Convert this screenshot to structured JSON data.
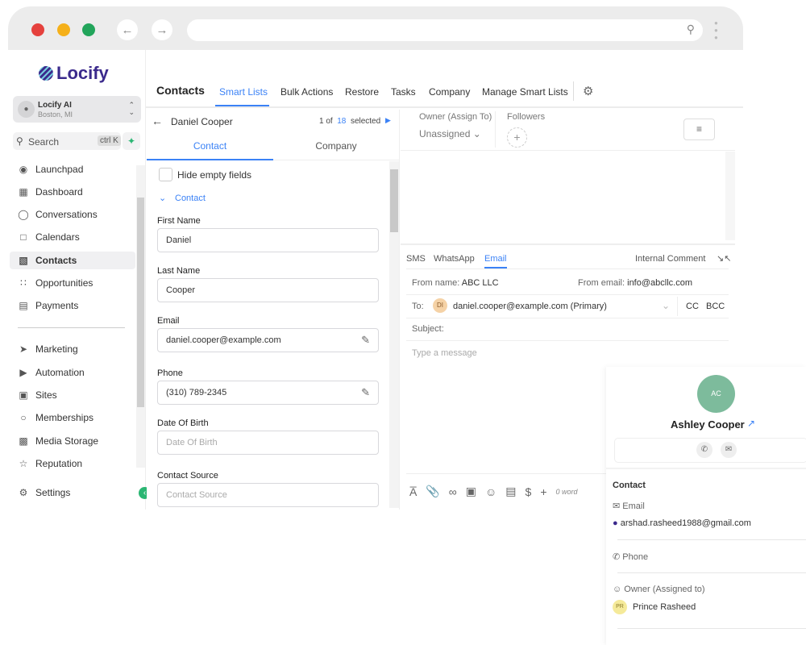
{
  "browser": {
    "url": ""
  },
  "brand": {
    "logo": "Locify"
  },
  "account": {
    "name": "Locify AI",
    "location": "Boston, MI"
  },
  "search": {
    "label": "Search",
    "shortcut": "ctrl K"
  },
  "sidebar": {
    "items": [
      {
        "label": "Launchpad",
        "icon": "rocket-icon"
      },
      {
        "label": "Dashboard",
        "icon": "grid-icon"
      },
      {
        "label": "Conversations",
        "icon": "chat-icon"
      },
      {
        "label": "Calendars",
        "icon": "calendar-icon"
      },
      {
        "label": "Contacts",
        "icon": "contact-icon",
        "active": true
      },
      {
        "label": "Opportunities",
        "icon": "opportunities-icon"
      },
      {
        "label": "Payments",
        "icon": "payments-icon"
      },
      {
        "label": "Marketing",
        "icon": "send-icon"
      },
      {
        "label": "Automation",
        "icon": "automation-icon"
      },
      {
        "label": "Sites",
        "icon": "sites-icon"
      },
      {
        "label": "Memberships",
        "icon": "badge-icon"
      },
      {
        "label": "Media Storage",
        "icon": "image-icon"
      },
      {
        "label": "Reputation",
        "icon": "star-icon"
      }
    ],
    "settings": "Settings"
  },
  "header": {
    "title": "Contacts",
    "tabs": [
      "Smart Lists",
      "Bulk Actions",
      "Restore",
      "Tasks",
      "Company",
      "Manage Smart Lists"
    ],
    "active_tab": "Smart Lists"
  },
  "record": {
    "name": "Daniel Cooper",
    "pos": "1 of",
    "total": "18",
    "selected": "selected",
    "tabs": [
      "Contact",
      "Company"
    ],
    "hide_empty": "Hide empty fields",
    "section": "Contact"
  },
  "fields": [
    {
      "label": "First Name",
      "value": "Daniel",
      "placeholder": ""
    },
    {
      "label": "Last Name",
      "value": "Cooper",
      "placeholder": ""
    },
    {
      "label": "Email",
      "value": "daniel.cooper@example.com",
      "placeholder": "",
      "edit": true
    },
    {
      "label": "Phone",
      "value": "(310) 789-2345",
      "placeholder": "",
      "edit": true
    },
    {
      "label": "Date Of Birth",
      "value": "",
      "placeholder": "Date Of Birth"
    },
    {
      "label": "Contact Source",
      "value": "",
      "placeholder": "Contact Source"
    }
  ],
  "owner": {
    "label": "Owner (Assign To)",
    "value": "Unassigned",
    "followers": "Followers"
  },
  "composer": {
    "channels": [
      "SMS",
      "WhatsApp",
      "Email"
    ],
    "active": "Email",
    "internal": "Internal Comment",
    "from_name_label": "From name:",
    "from_name": "ABC LLC",
    "from_email_label": "From email:",
    "from_email": "info@abcllc.com",
    "to_label": "To:",
    "to_initials": "DI",
    "to": "daniel.cooper@example.com (Primary)",
    "cc": "CC",
    "bcc": "BCC",
    "subject_label": "Subject:",
    "message_placeholder": "Type a message",
    "word_count": "0 word"
  },
  "contact_card": {
    "initials": "AC",
    "name": "Ashley Cooper",
    "section": "Contact",
    "email_label": "Email",
    "email": "arshad.rasheed1988@gmail.com",
    "phone_label": "Phone",
    "owner_label": "Owner (Assigned to)",
    "owner_initials": "PR",
    "owner": "Prince Rasheed",
    "avatar_color": "#7dbb9c"
  },
  "colors": {
    "accent": "#3b82f6",
    "brand": "#3b2a8c"
  }
}
